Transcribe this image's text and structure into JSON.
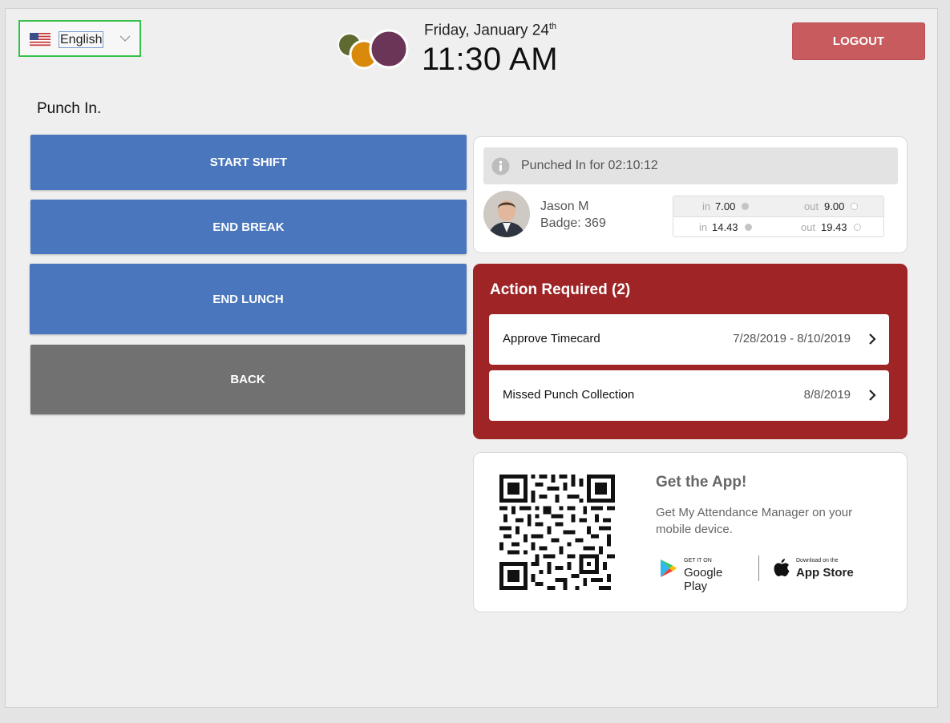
{
  "header": {
    "language": "English",
    "date_prefix": "Friday, January 24",
    "date_suffix": "th",
    "time": "11:30 AM",
    "logout_label": "LOGOUT"
  },
  "page_title": "Punch In.",
  "actions": [
    {
      "label": "START SHIFT"
    },
    {
      "label": "END BREAK"
    },
    {
      "label": "END LUNCH"
    },
    {
      "label": "BACK"
    }
  ],
  "status": {
    "message": "Punched In for 02:10:12"
  },
  "employee": {
    "name": "Jason M",
    "badge": "Badge: 369"
  },
  "punches": [
    {
      "in_label": "in",
      "in_value": "7.00",
      "out_label": "out",
      "out_value": "9.00"
    },
    {
      "in_label": "in",
      "in_value": "14.43",
      "out_label": "out",
      "out_value": "19.43"
    }
  ],
  "action_required": {
    "title": "Action Required (2)",
    "items": [
      {
        "name": "Approve Timecard",
        "range": "7/28/2019 - 8/10/2019"
      },
      {
        "name": "Missed Punch Collection",
        "range": "8/8/2019"
      }
    ]
  },
  "app_promo": {
    "title": "Get the App!",
    "description": "Get My Attendance Manager on your mobile device.",
    "google_small": "GET IT ON",
    "google_big": "Google Play",
    "apple_small": "Download on the",
    "apple_big": "App Store"
  },
  "colors": {
    "primary_button": "#4a76bd",
    "back_button": "#717171",
    "logout": "#c75b5e",
    "action_required": "#9e2426",
    "selector_border": "#36c24a"
  },
  "icons": [
    "us-flag-icon",
    "chevron-down-icon",
    "brand-logo",
    "info-icon",
    "chevron-right-icon",
    "qr-code",
    "google-play-icon",
    "apple-icon"
  ]
}
